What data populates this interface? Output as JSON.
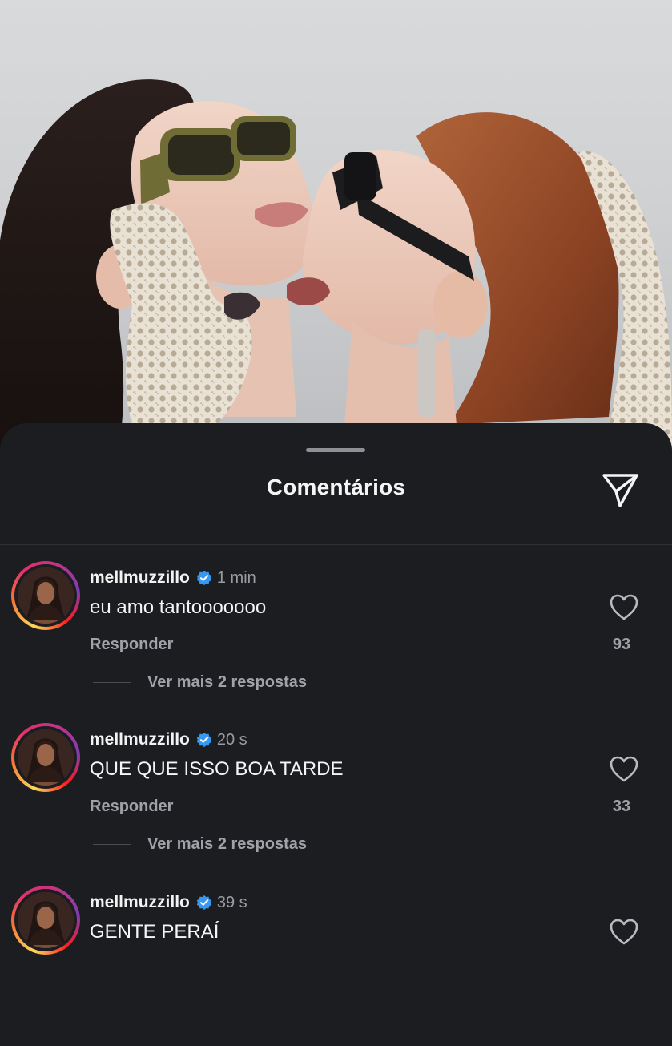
{
  "sheet": {
    "title": "Comentários"
  },
  "comments": [
    {
      "username": "mellmuzzillo",
      "verified": true,
      "time": "1 min",
      "text": "eu amo tantooooooo",
      "reply_label": "Responder",
      "likes": "93",
      "more_replies": "Ver mais 2 respostas"
    },
    {
      "username": "mellmuzzillo",
      "verified": true,
      "time": "20 s",
      "text": "QUE QUE ISSO BOA TARDE",
      "reply_label": "Responder",
      "likes": "33",
      "more_replies": "Ver mais 2 respostas"
    },
    {
      "username": "mellmuzzillo",
      "verified": true,
      "time": "39 s",
      "text": "GENTE PERAÍ"
    }
  ],
  "icons": {
    "share": "paper-plane-icon",
    "like": "heart-icon",
    "verified": "verified-badge-icon"
  },
  "colors": {
    "sheet_background": "#1b1d21",
    "verified_blue": "#3897f0",
    "text_primary": "#f5f5f5",
    "text_secondary": "#a0a2a7"
  }
}
